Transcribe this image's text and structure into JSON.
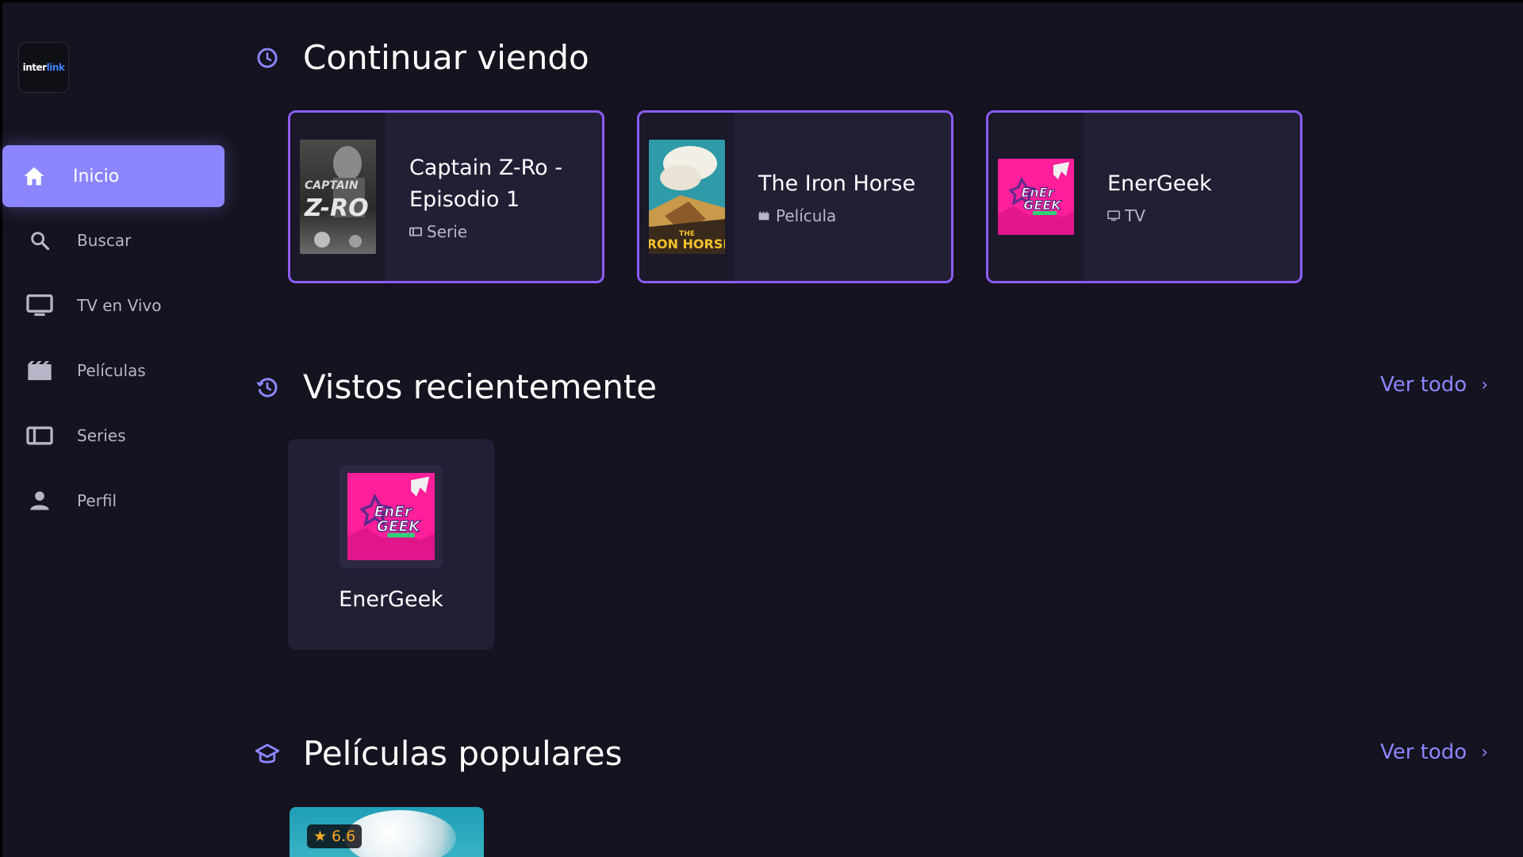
{
  "brand": {
    "logo_text_a": "inter",
    "logo_text_b": "link"
  },
  "sidebar": {
    "items": [
      {
        "label": "Inicio",
        "icon": "home-icon",
        "active": true
      },
      {
        "label": "Buscar",
        "icon": "search-icon"
      },
      {
        "label": "TV en Vivo",
        "icon": "tv-icon"
      },
      {
        "label": "Películas",
        "icon": "film-icon"
      },
      {
        "label": "Series",
        "icon": "series-icon"
      },
      {
        "label": "Perfil",
        "icon": "person-icon"
      }
    ]
  },
  "continue_watching": {
    "title": "Continuar viendo",
    "icon": "clock-icon",
    "items": [
      {
        "title": "Captain Z-Ro - Episodio 1",
        "type": "Serie",
        "type_icon": "series-icon"
      },
      {
        "title": "The Iron Horse",
        "type": "Película",
        "type_icon": "film-icon"
      },
      {
        "title": "EnerGeek",
        "type": "TV",
        "type_icon": "tv-icon"
      }
    ]
  },
  "recently_viewed": {
    "title": "Vistos recientemente",
    "icon": "history-icon",
    "see_all": "Ver todo",
    "items": [
      {
        "title": "EnerGeek"
      }
    ]
  },
  "popular_movies": {
    "title": "Películas populares",
    "icon": "graduation-icon",
    "see_all": "Ver todo",
    "items": [
      {
        "rating": "6.6"
      }
    ]
  },
  "colors": {
    "accent": "#8b86ff",
    "card_border": "#8b5cf6",
    "background": "#14131f",
    "card_bg": "#221f35",
    "rating": "#f5a623"
  }
}
